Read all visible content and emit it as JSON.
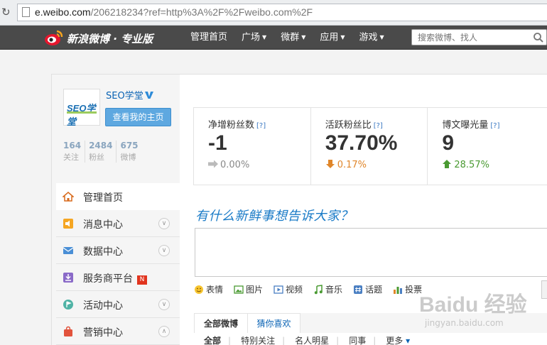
{
  "browser": {
    "url_host": "e.weibo.com",
    "url_path": "/206218234?ref=http%3A%2F%2Fweibo.com%2F"
  },
  "topnav": {
    "logo_text": "新浪微博 · 专业版",
    "items": [
      {
        "label": "管理首页",
        "has_caret": false
      },
      {
        "label": "广场",
        "has_caret": true
      },
      {
        "label": "微群",
        "has_caret": true
      },
      {
        "label": "应用",
        "has_caret": true
      },
      {
        "label": "游戏",
        "has_caret": true
      }
    ],
    "search_placeholder": "搜索微博、找人"
  },
  "profile": {
    "avatar_text": "SEO学堂",
    "username": "SEO学堂",
    "home_button": "查看我的主页",
    "stats": [
      {
        "num": "164",
        "label": "关注"
      },
      {
        "num": "2484",
        "label": "粉丝"
      },
      {
        "num": "675",
        "label": "微博"
      }
    ]
  },
  "menu": [
    {
      "label": "管理首页",
      "icon": "house-icon",
      "active": true,
      "toggle": ""
    },
    {
      "label": "消息中心",
      "icon": "speaker-icon",
      "active": false,
      "toggle": "down"
    },
    {
      "label": "数据中心",
      "icon": "envelope-icon",
      "active": false,
      "toggle": "down"
    },
    {
      "label": "服务商平台",
      "icon": "download-icon",
      "active": false,
      "toggle": "",
      "badge": "new"
    },
    {
      "label": "活动中心",
      "icon": "flag-icon",
      "active": false,
      "toggle": "down"
    },
    {
      "label": "营销中心",
      "icon": "bag-icon",
      "active": false,
      "toggle": "up"
    }
  ],
  "metrics": [
    {
      "title": "净增粉丝数",
      "help": "[?]",
      "value": "-1",
      "change": "0.00%",
      "trend": "flat",
      "color": "#888888"
    },
    {
      "title": "活跃粉丝比",
      "help": "[?]",
      "value": "37.70%",
      "change": "0.17%",
      "trend": "down",
      "color": "#e0862a"
    },
    {
      "title": "博文曝光量",
      "help": "[?]",
      "value": "9",
      "change": "28.57%",
      "trend": "up",
      "color": "#4a9a32"
    }
  ],
  "publisher": {
    "title": "有什么新鲜事想告诉大家？",
    "tools": [
      {
        "label": "表情",
        "icon": "smiley-icon"
      },
      {
        "label": "图片",
        "icon": "picture-icon"
      },
      {
        "label": "视频",
        "icon": "video-icon"
      },
      {
        "label": "音乐",
        "icon": "music-icon"
      },
      {
        "label": "话题",
        "icon": "topic-icon"
      },
      {
        "label": "投票",
        "icon": "poll-icon"
      }
    ]
  },
  "feed": {
    "tabs": [
      "全部微博",
      "猜你喜欢"
    ],
    "subtabs": [
      "全部",
      "特别关注",
      "名人明星",
      "同事",
      "更多"
    ]
  },
  "watermark": {
    "main": "Baidu 经验",
    "sub": "jingyan.baidu.com"
  },
  "colors": {
    "nav_bg": "#4a4a4a",
    "link_blue": "#0a63b4",
    "button_blue": "#5ea8e0"
  }
}
